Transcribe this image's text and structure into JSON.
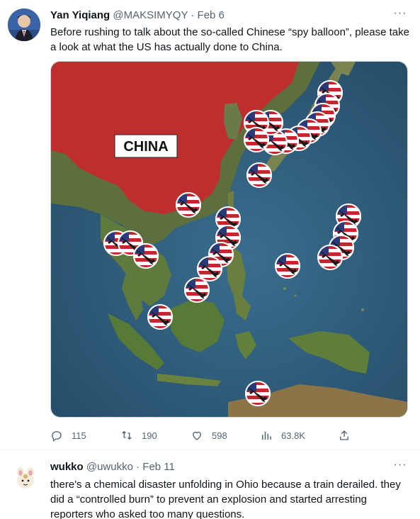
{
  "tweets": [
    {
      "author_name": "Yan Yiqiang",
      "handle": "@MAKSIMYQY",
      "separator": "·",
      "date": "Feb 6",
      "text": "Before rushing to talk about the so-called Chinese “spy balloon”, please take a look at what the US has actually done to China.",
      "media": {
        "map_label": "CHINA",
        "marker_count": 28
      },
      "actions": {
        "replies": "115",
        "retweets": "190",
        "likes": "598",
        "views": "63.8K"
      }
    },
    {
      "author_name": "wukko",
      "handle": "@uwukko",
      "separator": "·",
      "date": "Feb 11",
      "text": "there's a chemical disaster unfolding in Ohio because a train derailed. they did a “controlled burn” to prevent an explosion and started arresting reporters who asked too many questions."
    }
  ],
  "icons": {
    "more": "more-dots-icon",
    "reply": "reply-icon",
    "retweet": "retweet-icon",
    "like": "heart-icon",
    "views": "views-bar-icon",
    "share": "share-icon"
  },
  "colors": {
    "text_primary": "#0f1419",
    "text_secondary": "#536471",
    "china_region": "#c8282d",
    "ocean": "#2e5a78"
  }
}
